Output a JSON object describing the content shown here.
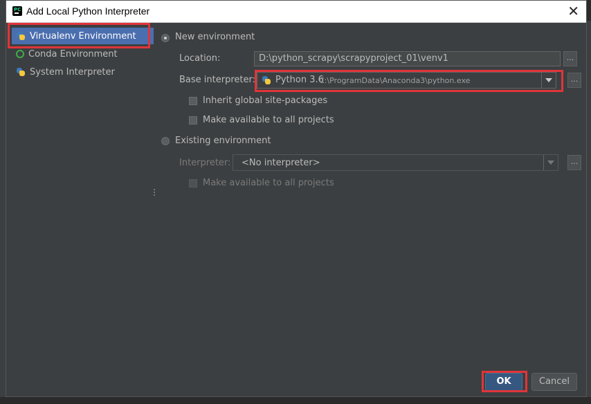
{
  "window": {
    "title": "Add Local Python Interpreter",
    "close_icon": "close-icon",
    "app_icon": "pycharm-icon",
    "app_icon_text": "PC"
  },
  "sidebar": {
    "items": [
      {
        "label": "Virtualenv Environment",
        "icon": "python-icon",
        "selected": true
      },
      {
        "label": "Conda Environment",
        "icon": "conda-icon",
        "selected": false
      },
      {
        "label": "System Interpreter",
        "icon": "python-icon",
        "selected": false
      }
    ]
  },
  "new_env": {
    "radio_label": "New environment",
    "selected": true,
    "location_label": "Location:",
    "location_value": "D:\\python_scrapy\\scrapyproject_01\\venv1",
    "browse_label": "...",
    "base_label": "Base interpreter:",
    "base_version": "Python 3.6",
    "base_path": "C:\\ProgramData\\Anaconda3\\python.exe",
    "inherit_label": "Inherit global site-packages",
    "make_available_label": "Make available to all projects"
  },
  "existing_env": {
    "radio_label": "Existing environment",
    "selected": false,
    "interpreter_label": "Interpreter:",
    "interpreter_value": "<No interpreter>",
    "make_available_label": "Make available to all projects"
  },
  "buttons": {
    "ok": "OK",
    "cancel": "Cancel"
  },
  "colors": {
    "highlight": "#e0353a",
    "selection": "#4b6eaf",
    "ok_button": "#365880"
  }
}
